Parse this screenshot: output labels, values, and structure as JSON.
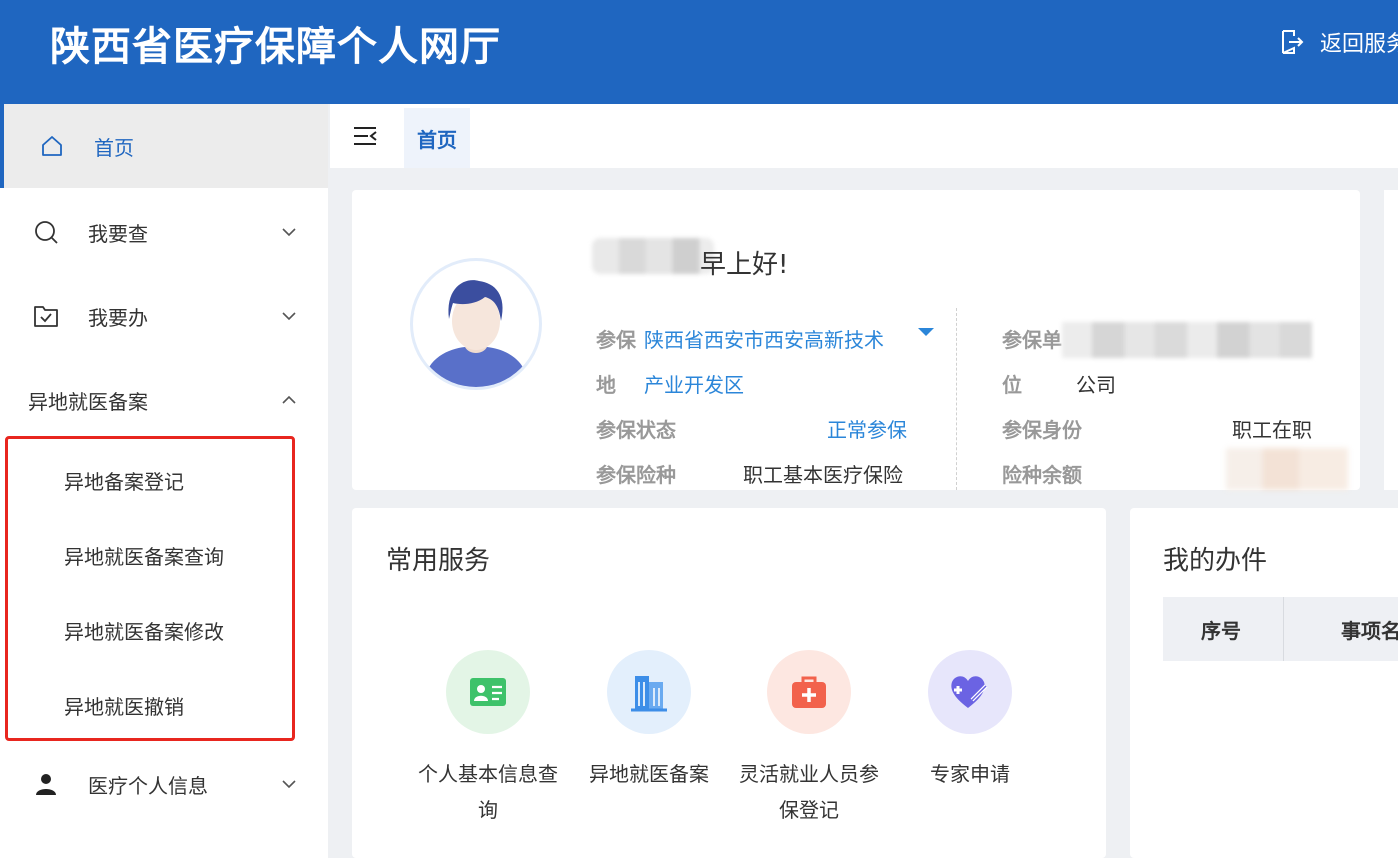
{
  "header": {
    "title": "陕西省医疗保障个人网厅",
    "back_label": "返回服务"
  },
  "sidebar": {
    "home": "首页",
    "items": [
      {
        "label": "我要查",
        "icon": "search-icon"
      },
      {
        "label": "我要办",
        "icon": "folder-check-icon"
      }
    ],
    "group": {
      "label": "异地就医备案",
      "expanded": true,
      "subitems": [
        "异地备案登记",
        "异地就医备案查询",
        "异地就医备案修改",
        "异地就医撤销"
      ]
    },
    "personal": {
      "label": "医疗个人信息",
      "icon": "person-icon"
    }
  },
  "tabs": {
    "active": "首页"
  },
  "profile": {
    "greeting": "早上好!",
    "insured_place_label_1": "参保",
    "insured_place_label_2": "地",
    "insured_place_value_1": "陕西省西安市西安高新技术",
    "insured_place_value_2": "产业开发区",
    "status_label": "参保状态",
    "status_value": "正常参保",
    "insurance_type_label": "参保险种",
    "insurance_type_value": "职工基本医疗保险",
    "unit_label_1": "参保单",
    "unit_label_2": "位",
    "unit_value_suffix": "公司",
    "identity_label": "参保身份",
    "identity_value": "职工在职",
    "balance_label": "险种余额"
  },
  "services": {
    "title": "常用服务",
    "items": [
      {
        "label": "个人基本信息查询",
        "icon": "id-card-icon",
        "bg": "#e3f5e6",
        "color": "#3ec26a"
      },
      {
        "label": "异地就医备案",
        "icon": "building-icon",
        "bg": "#e3effc",
        "color": "#3d8ee8"
      },
      {
        "label": "灵活就业人员参保登记",
        "icon": "medical-kit-icon",
        "bg": "#fde7e1",
        "color": "#f2624c"
      },
      {
        "label": "专家申请",
        "icon": "heart-edit-icon",
        "bg": "#e7e6fb",
        "color": "#6b63e3"
      }
    ]
  },
  "tasks": {
    "title": "我的办件",
    "columns": [
      "序号",
      "事项名"
    ]
  },
  "colors": {
    "brand": "#1f66c0",
    "link": "#2b86d9",
    "highlight_box": "#e8261f"
  }
}
